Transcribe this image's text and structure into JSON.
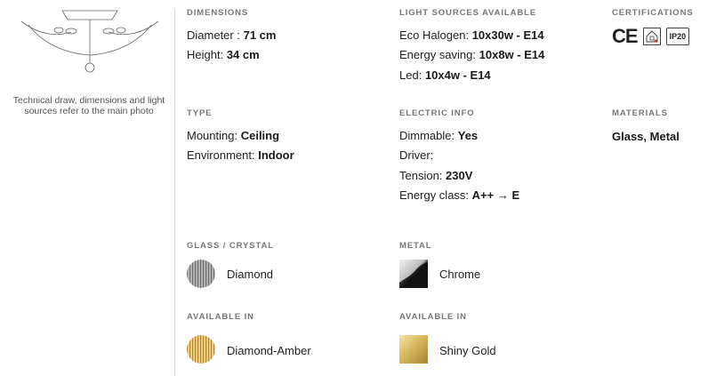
{
  "caption": "Technical draw, dimensions and light sources refer to the main photo",
  "dimensions": {
    "title": "DIMENSIONS",
    "diameter_label": "Diameter :",
    "diameter_value": "71 cm",
    "height_label": "Height:",
    "height_value": "34 cm"
  },
  "light_sources": {
    "title": "LIGHT SOURCES AVAILABLE",
    "items": [
      {
        "label": "Eco Halogen:",
        "value": "10x30w - E14"
      },
      {
        "label": "Energy saving:",
        "value": "10x8w - E14"
      },
      {
        "label": "Led:",
        "value": "10x4w - E14"
      }
    ]
  },
  "certifications": {
    "title": "CERTIFICATIONS",
    "ce": "CE",
    "ip": "IP20",
    "icons": [
      "ce-mark-icon",
      "indoor-house-icon",
      "ip20-icon"
    ]
  },
  "type": {
    "title": "TYPE",
    "mounting_label": "Mounting:",
    "mounting_value": "Ceiling",
    "environment_label": "Environment:",
    "environment_value": "Indoor"
  },
  "electric": {
    "title": "ELECTRIC INFO",
    "dimmable_label": "Dimmable:",
    "dimmable_value": "Yes",
    "driver_label": "Driver:",
    "tension_label": "Tension:",
    "tension_value": "230V",
    "energy_label": "Energy class:",
    "energy_value": "A++ → E"
  },
  "materials": {
    "title": "MATERIALS",
    "value": "Glass, Metal"
  },
  "glass": {
    "title": "GLASS / CRYSTAL",
    "name": "Diamond",
    "available_title": "AVAILABLE IN",
    "available_name": "Diamond-Amber"
  },
  "metal": {
    "title": "METAL",
    "name": "Chrome",
    "available_title": "AVAILABLE IN",
    "available_name": "Shiny Gold"
  },
  "colors": {
    "divider": "#d6d6d6",
    "text": "#222222",
    "section_title": "#777777",
    "gold": "#c9a94a",
    "amber": "#d9a441"
  }
}
